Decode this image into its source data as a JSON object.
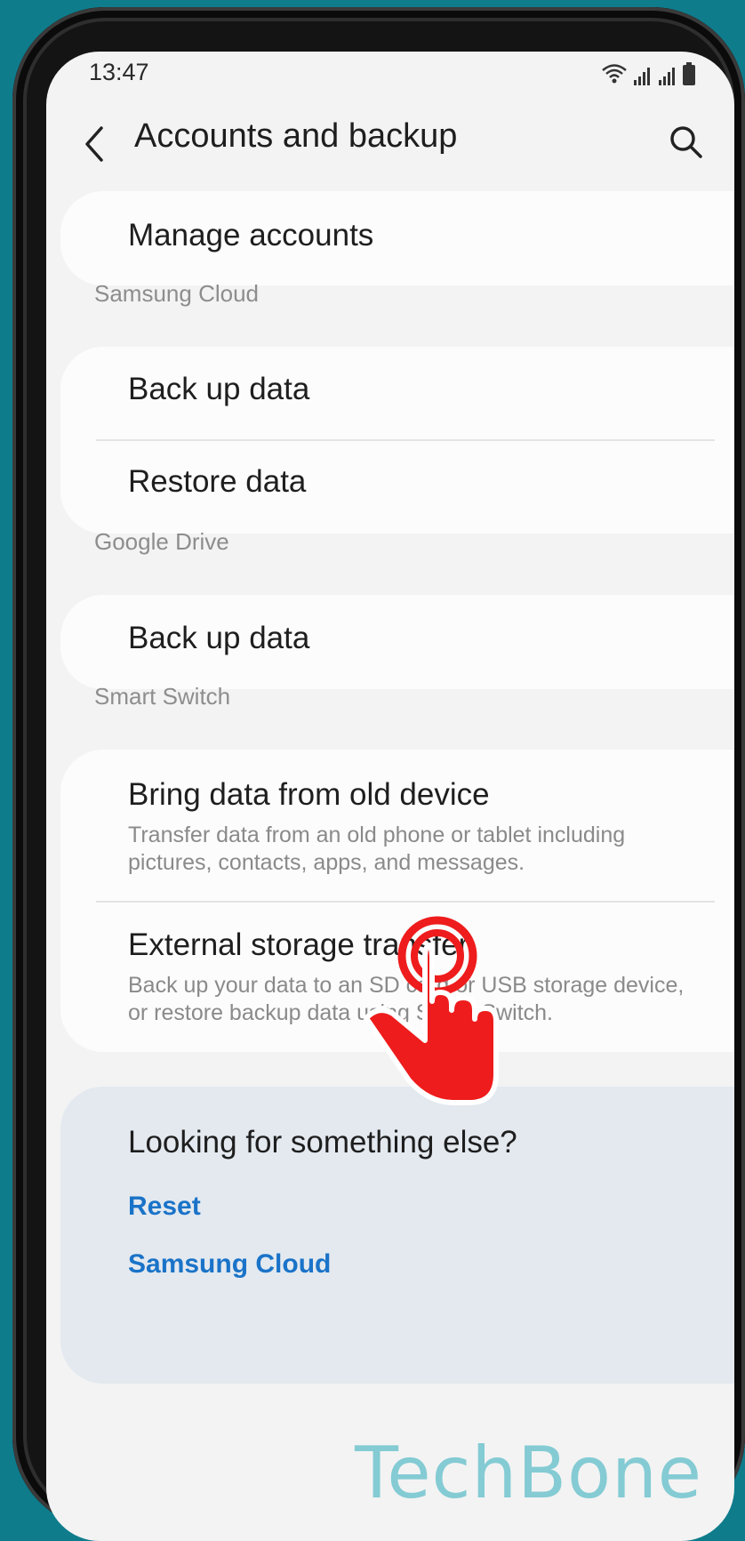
{
  "status_bar": {
    "time": "13:47"
  },
  "app_bar": {
    "title": "Accounts and backup"
  },
  "groups": [
    {
      "label": "",
      "items": [
        {
          "title": "Manage accounts"
        }
      ]
    },
    {
      "label": "Samsung Cloud",
      "items": [
        {
          "title": "Back up data"
        },
        {
          "title": "Restore data"
        }
      ]
    },
    {
      "label": "Google Drive",
      "items": [
        {
          "title": "Back up data"
        }
      ]
    },
    {
      "label": "Smart Switch",
      "items": [
        {
          "title": "Bring data from old device",
          "subtitle": "Transfer data from an old phone or tablet including pictures, contacts, apps, and messages."
        },
        {
          "title": "External storage transfer",
          "subtitle": "Back up your data to an SD card or USB storage device, or restore backup data using Smart Switch."
        }
      ]
    }
  ],
  "suggestions": {
    "title": "Looking for something else?",
    "links": [
      "Reset",
      "Samsung Cloud"
    ]
  },
  "watermark": "TechBone",
  "colors": {
    "background": "#0f7c8c",
    "link": "#1a73c8",
    "tap_indicator": "#ee1c1c"
  },
  "icons": {
    "back": "chevron-left-icon",
    "search": "search-icon",
    "wifi": "wifi-icon",
    "signal": "signal-icon",
    "battery": "battery-icon",
    "tap": "tap-hand-icon"
  }
}
